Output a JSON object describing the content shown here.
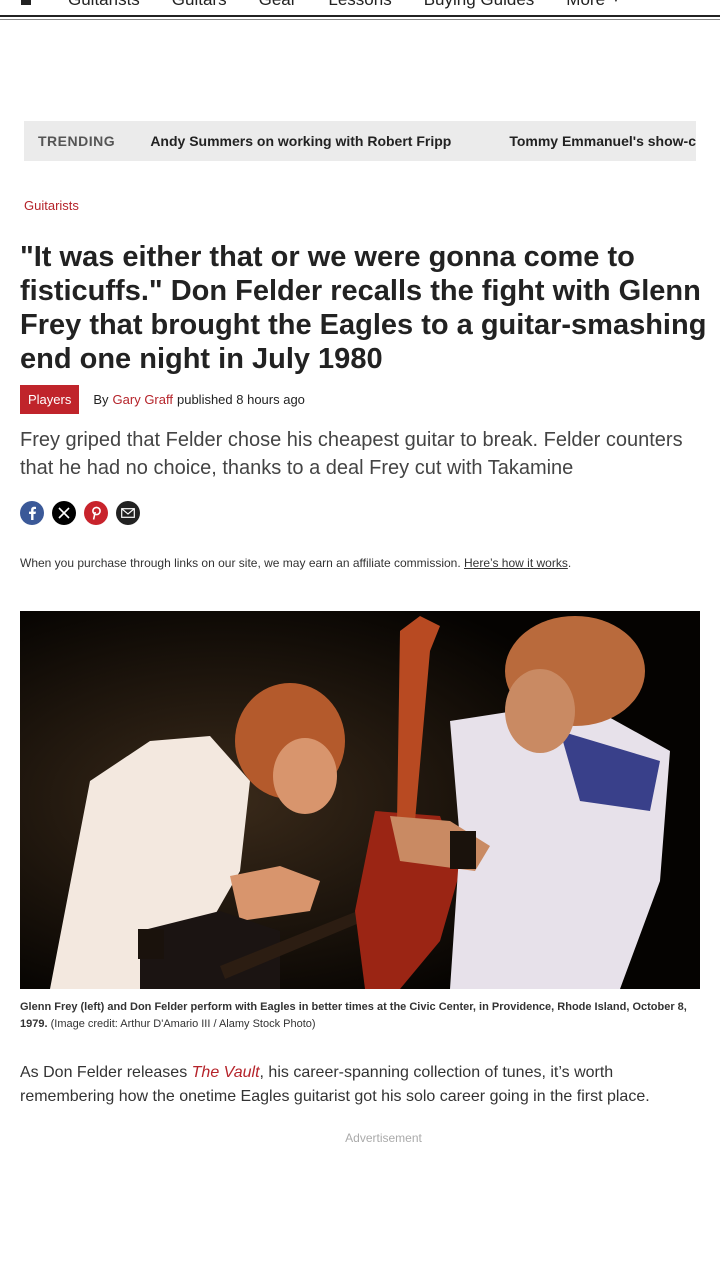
{
  "nav": {
    "items": [
      "Guitarists",
      "Guitars",
      "Gear",
      "Lessons",
      "Buying Guides"
    ],
    "more_label": "More"
  },
  "trending": {
    "label": "TRENDING",
    "links": [
      "Andy Summers on working with Robert Fripp",
      "Tommy Emmanuel's show-c"
    ]
  },
  "breadcrumb": "Guitarists",
  "headline": "\"It was either that or we were gonna come to fisticuffs.\" Don Felder recalls the fight with Glenn Frey that brought the Eagles to a guitar-smashing end one night in July 1980",
  "byline": {
    "badge": "Players",
    "by": "By",
    "author": "Gary Graff",
    "published": "published 8 hours ago"
  },
  "standfirst": "Frey griped that Felder chose his cheapest guitar to break. Felder counters that he had no choice, thanks to a deal Frey cut with Takamine",
  "affiliate": {
    "text": "When you purchase through links on our site, we may earn an affiliate commission.",
    "link": "Here’s how it works",
    "end": "."
  },
  "caption": {
    "bold": "Glenn Frey (left) and Don Felder perform with Eagles in better times at the Civic Center, in Providence, Rhode Island, October 8, 1979.",
    "credit": "(Image credit: Arthur D'Amario III / Alamy Stock Photo)"
  },
  "body": {
    "pre": "As Don Felder releases ",
    "link": "The Vault",
    "post": ", his career-spanning collection of tunes, it’s worth remembering how the onetime Eagles guitarist got his solo career going in the first place."
  },
  "advertisement": "Advertisement",
  "icons": [
    "home-icon",
    "caret-down-icon",
    "facebook-icon",
    "x-icon",
    "pinterest-icon",
    "email-icon"
  ],
  "colors": {
    "accent": "#c0242b",
    "trending_bg": "#ebebeb"
  }
}
